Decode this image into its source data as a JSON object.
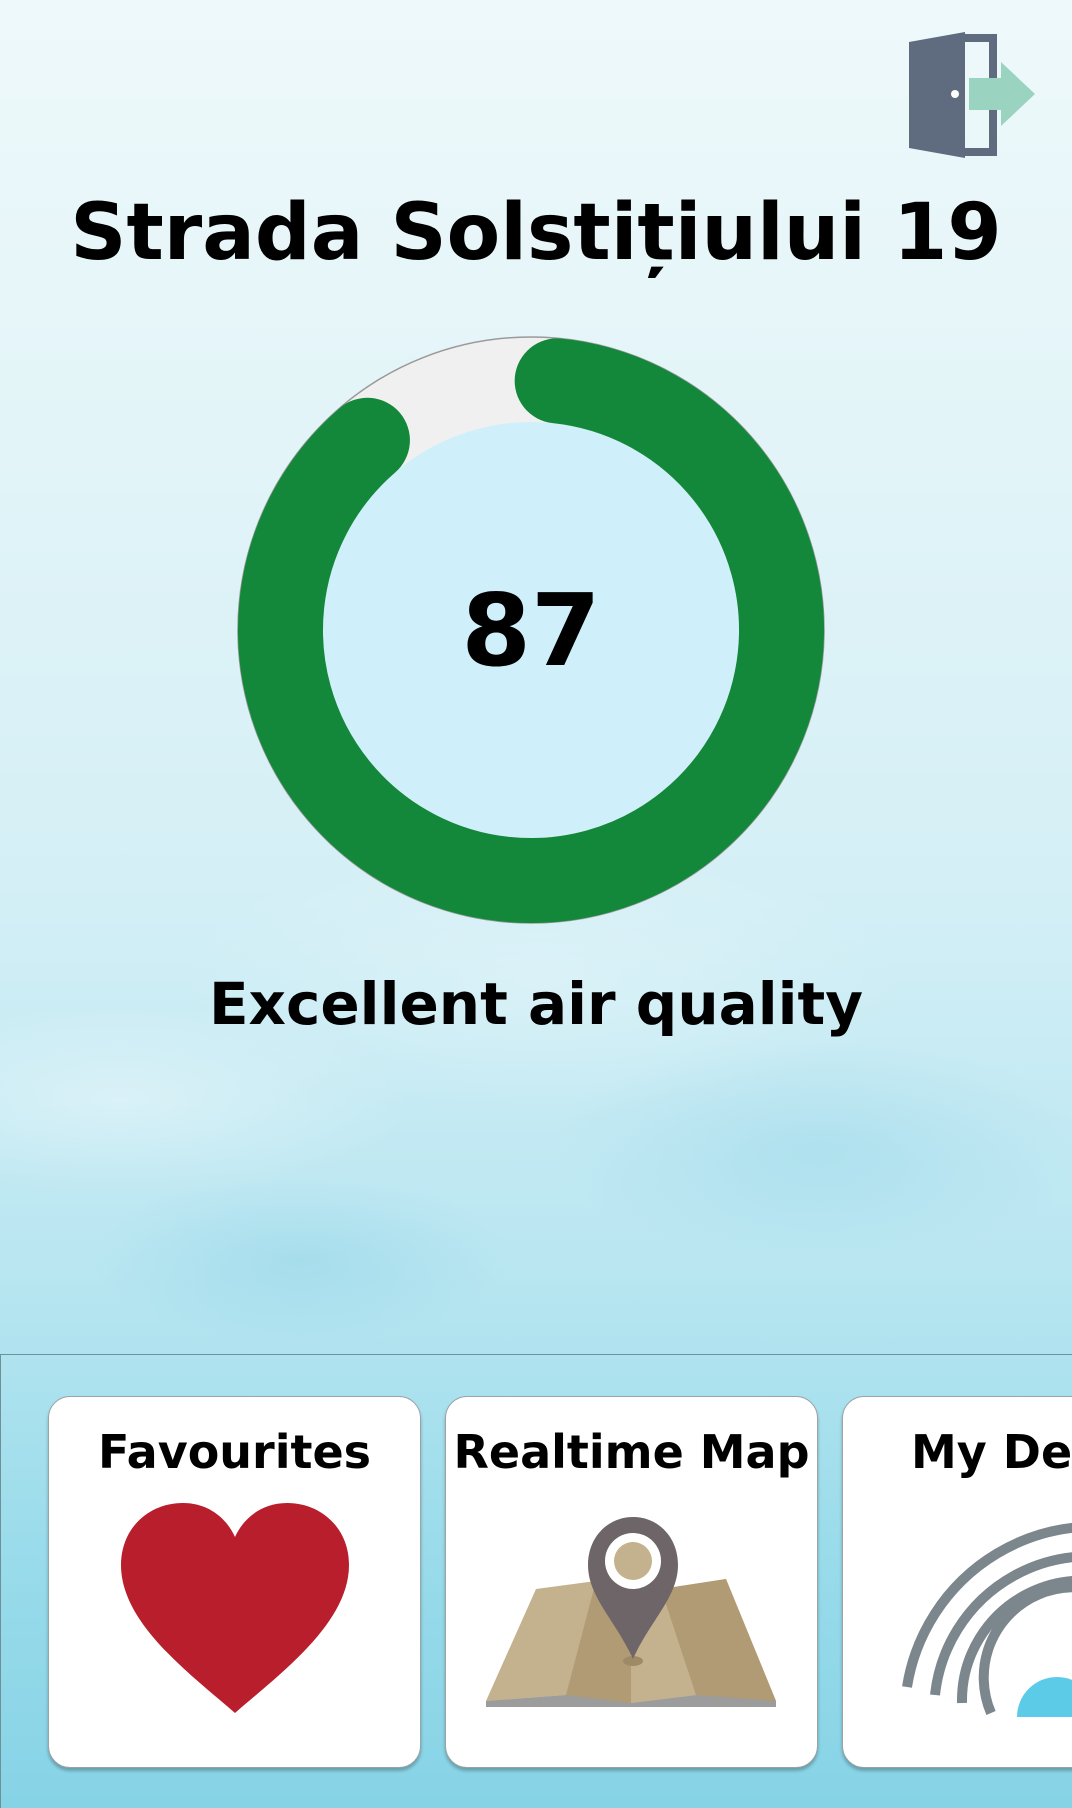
{
  "header": {
    "title": "Strada Solstițiului 19",
    "logout_icon": "logout-door-icon"
  },
  "air_quality": {
    "score": "87",
    "score_fraction": 0.87,
    "status_text": "Excellent air quality",
    "gauge_color": "#13873a",
    "track_color": "#f0f0f0",
    "inner_color": "#cff0fa"
  },
  "nav": {
    "cards": [
      {
        "label": "Favourites",
        "icon": "heart-icon"
      },
      {
        "label": "Realtime Map",
        "icon": "map-pin-icon"
      },
      {
        "label": "My Dev",
        "icon": "wifi-signal-icon"
      }
    ]
  },
  "colors": {
    "heart": "#b81e2c",
    "map_paper": "#c4b18d",
    "pin": "#6e6568",
    "wifi": "#7b868d",
    "wifi_dot": "#5bcbe8"
  }
}
